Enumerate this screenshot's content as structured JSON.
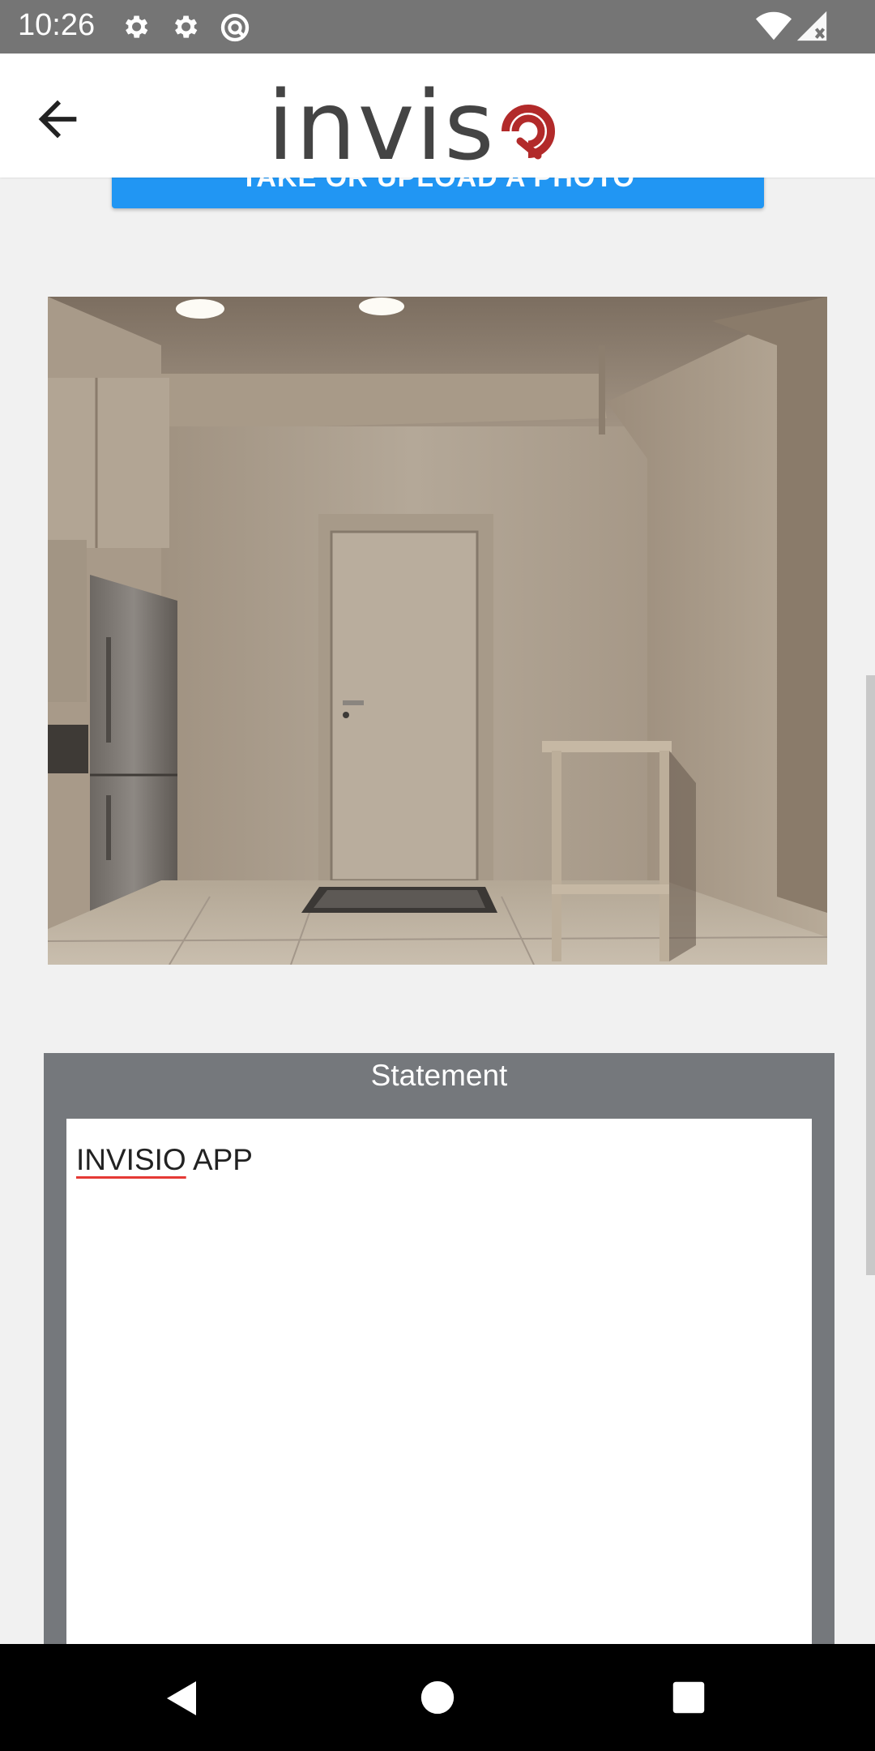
{
  "status_bar": {
    "time": "10:26",
    "left_icons": [
      "gear-icon",
      "gear-icon",
      "sync-circle-icon"
    ],
    "right_icons": [
      "wifi-icon",
      "signal-icon"
    ]
  },
  "header": {
    "logo_text": "invis",
    "logo_mark": "o-swirl-icon",
    "brand_color": "#b22a2a"
  },
  "upload_button": {
    "label": "TAKE OR UPLOAD A PHOTO",
    "color": "#2196f3"
  },
  "statement": {
    "title": "Statement",
    "text_misspelled": "INVISIO",
    "text_rest": " APP"
  },
  "nav_bar": {
    "buttons": [
      "back-icon",
      "home-icon",
      "recents-icon"
    ]
  }
}
